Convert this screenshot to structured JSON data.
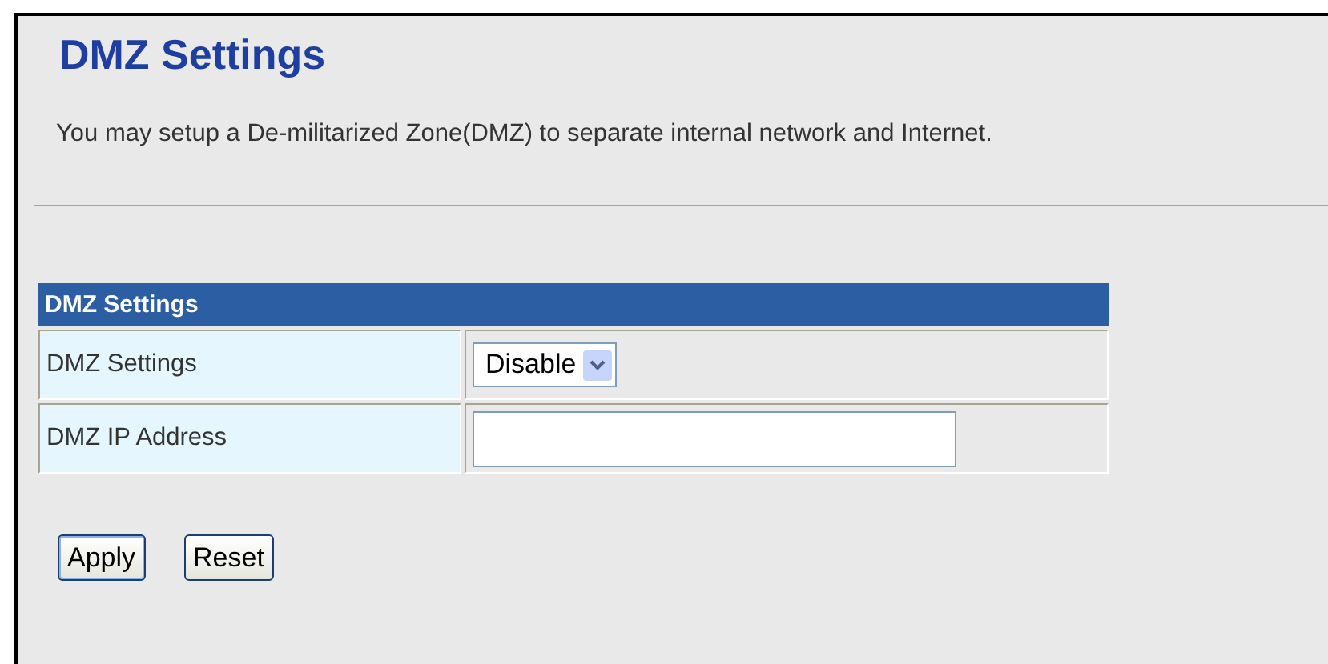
{
  "title": "DMZ Settings",
  "description": "You may setup a De-militarized Zone(DMZ) to separate internal network and Internet.",
  "table": {
    "header": "DMZ Settings",
    "rows": [
      {
        "kind": "select",
        "label": "DMZ Settings",
        "value": "Disable"
      },
      {
        "kind": "text",
        "label": "DMZ IP Address"
      }
    ]
  },
  "buttons": [
    "Apply",
    "Reset"
  ]
}
